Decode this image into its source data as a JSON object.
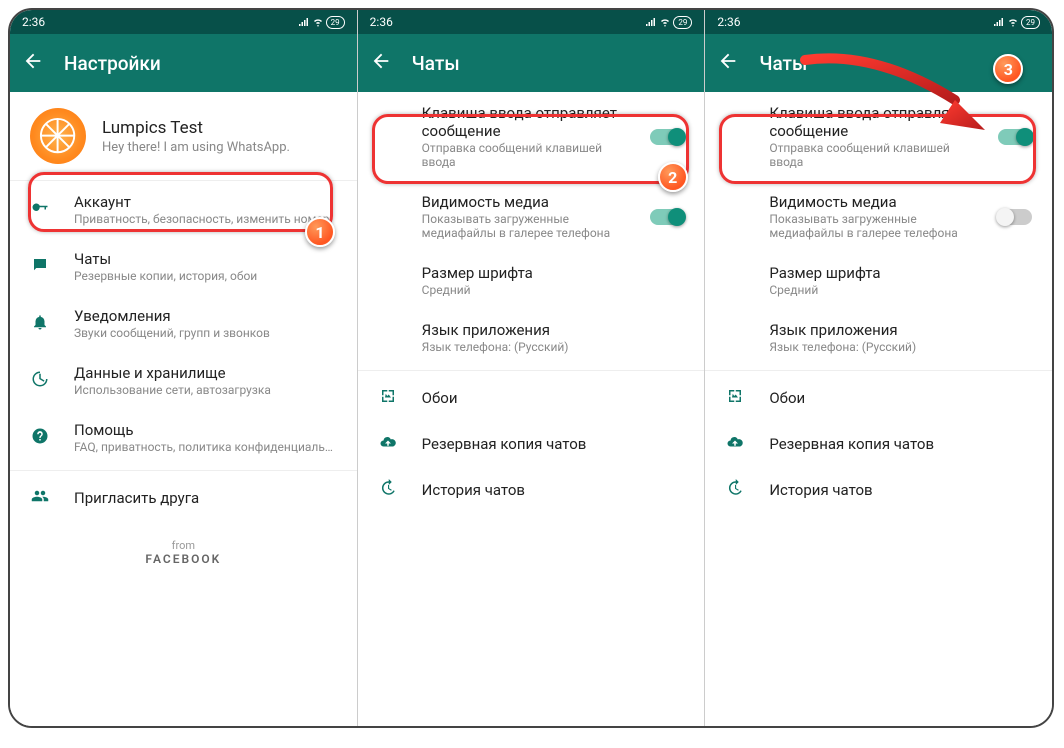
{
  "status": {
    "time": "2:36",
    "battery": "29"
  },
  "phone1": {
    "title": "Настройки",
    "profile": {
      "name": "Lumpics Test",
      "status": "Hey there! I am using WhatsApp."
    },
    "items": {
      "account": {
        "label": "Аккаунт",
        "sub": "Приватность, безопасность, изменить номер"
      },
      "chats": {
        "label": "Чаты",
        "sub": "Резервные копии, история, обои"
      },
      "notif": {
        "label": "Уведомления",
        "sub": "Звуки сообщений, групп и звонков"
      },
      "data": {
        "label": "Данные и хранилище",
        "sub": "Использование сети, автозагрузка"
      },
      "help": {
        "label": "Помощь",
        "sub": "FAQ, приватность, политика конфиденциальн..."
      },
      "invite": {
        "label": "Пригласить друга"
      }
    },
    "from": "from",
    "fb": "FACEBOOK"
  },
  "chats_screen": {
    "title": "Чаты",
    "enter": {
      "label": "Клавиша ввода отправляет сообщение",
      "sub": "Отправка сообщений клавишей ввода"
    },
    "media": {
      "label": "Видимость медиа",
      "sub": "Показывать загруженные медиафайлы в галерее телефона"
    },
    "font": {
      "label": "Размер шрифта",
      "sub": "Средний"
    },
    "lang": {
      "label": "Язык приложения",
      "sub": "Язык телефона: (Русский)"
    },
    "wall": {
      "label": "Обои"
    },
    "backup": {
      "label": "Резервная копия чатов"
    },
    "hist": {
      "label": "История чатов"
    }
  },
  "badges": {
    "b1": "1",
    "b2": "2",
    "b3": "3"
  }
}
